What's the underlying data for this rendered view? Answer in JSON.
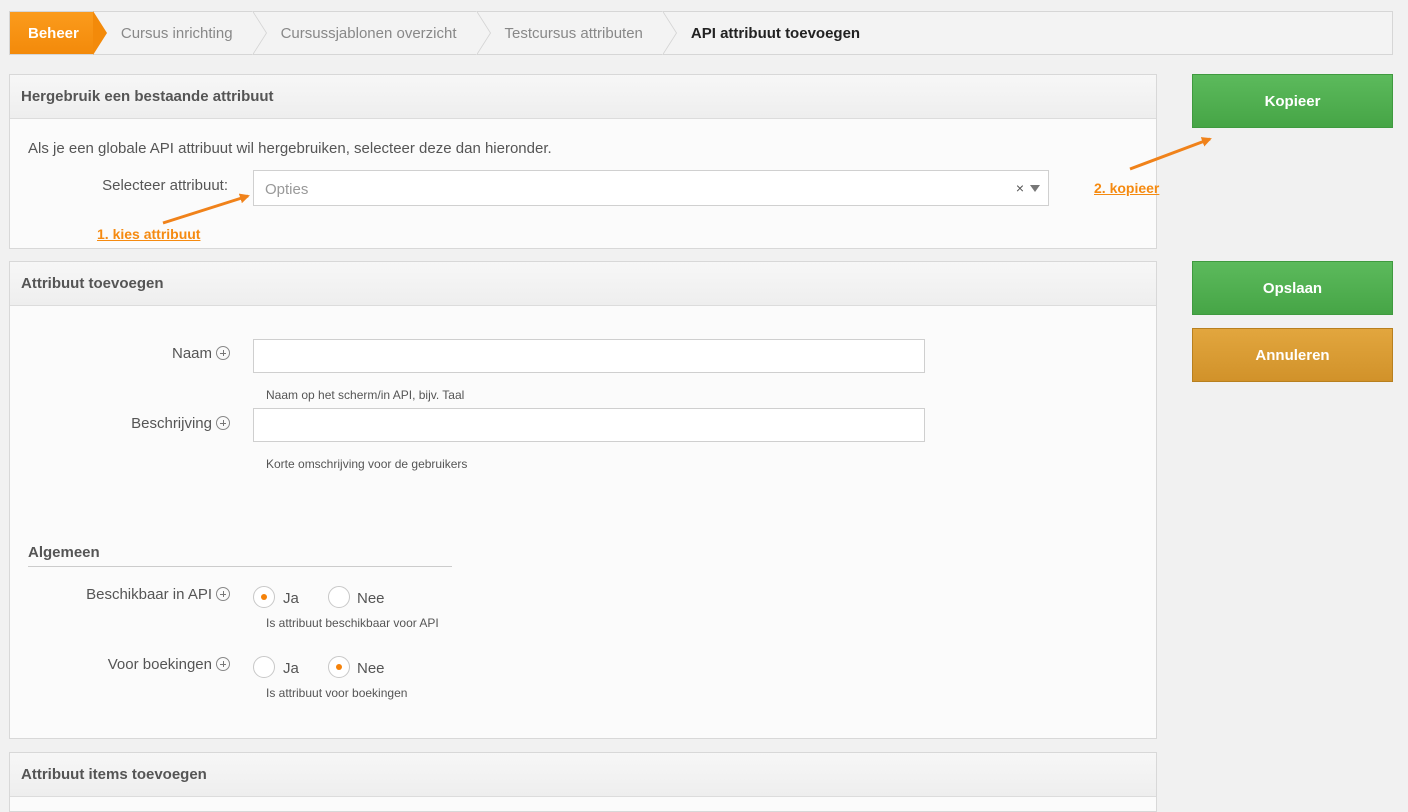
{
  "breadcrumb": {
    "home": "Beheer",
    "items": [
      "Cursus inrichting",
      "Cursussjablonen overzicht",
      "Testcursus attributen"
    ],
    "current": "API attribuut toevoegen"
  },
  "reuse_panel": {
    "title": "Hergebruik een bestaande attribuut",
    "info": "Als je een globale API attribuut wil hergebruiken, selecteer deze dan hieronder.",
    "select_label": "Selecteer attribuut:",
    "select_placeholder": "Opties",
    "clear_glyph": "×"
  },
  "annotations": {
    "step1": "1. kies attribuut",
    "step2": "2. kopieer",
    "color": "#f58a10"
  },
  "add_panel": {
    "title": "Attribuut toevoegen",
    "name_label": "Naam",
    "name_value": "",
    "name_help": "Naam op het scherm/in API, bijv. Taal",
    "desc_label": "Beschrijving",
    "desc_value": "",
    "desc_help": "Korte omschrijving voor de gebruikers",
    "section": "Algemeen",
    "api_label": "Beschikbaar in API",
    "api_yes": "Ja",
    "api_no": "Nee",
    "api_selected": "Ja",
    "api_help": "Is attribuut beschikbaar voor API",
    "book_label": "Voor boekingen",
    "book_yes": "Ja",
    "book_no": "Nee",
    "book_selected": "Nee",
    "book_help": "Is attribuut voor boekingen"
  },
  "items_panel": {
    "title": "Attribuut items toevoegen"
  },
  "buttons": {
    "copy": "Kopieer",
    "save": "Opslaan",
    "cancel": "Annuleren"
  },
  "colors": {
    "accent": "#f38a0a",
    "green": "#4fae4f",
    "amber": "#d89b33"
  }
}
